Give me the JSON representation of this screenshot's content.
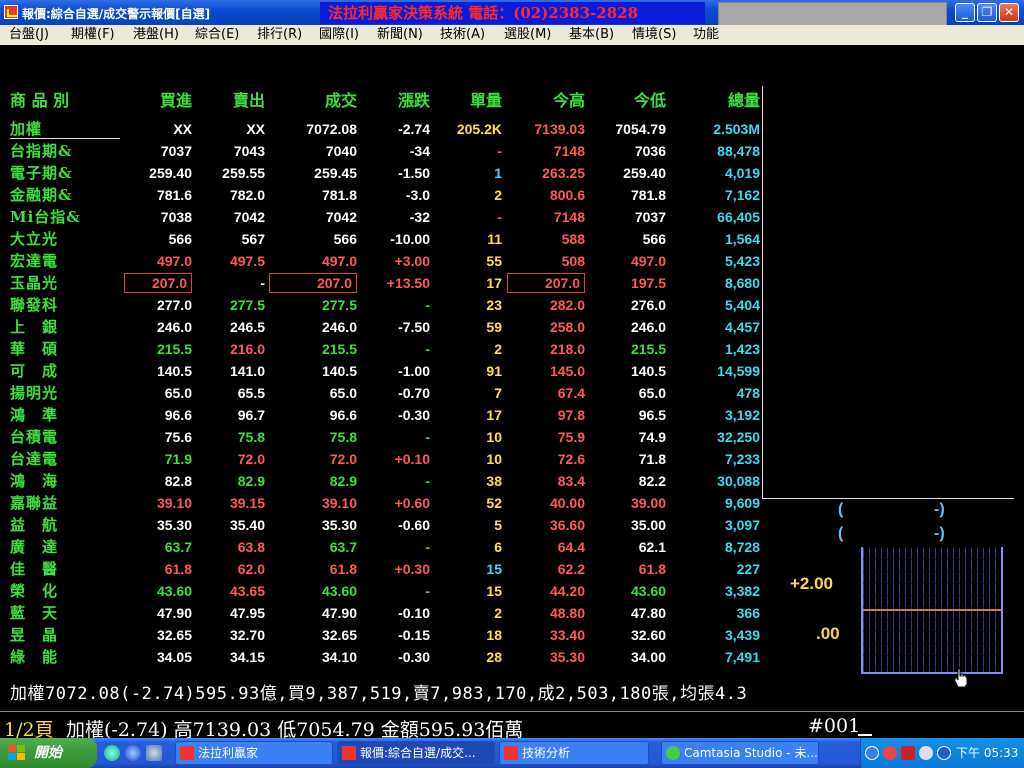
{
  "window": {
    "title": "報價:綜合自選/成交警示報價[自選]",
    "banner": "法拉利贏家決策系統 電話：(02)2383-2828",
    "btn_min": "_",
    "btn_max": "❐",
    "btn_close": "✕"
  },
  "menu": [
    {
      "label": "台盤(J)",
      "key": "台盤"
    },
    {
      "label": "期權(F)",
      "key": "期權"
    },
    {
      "label": "港盤(H)",
      "key": "港盤"
    },
    {
      "label": "綜合(E)",
      "key": "綜合"
    },
    {
      "label": "排行(R)",
      "key": "排行"
    },
    {
      "label": "國際(I)",
      "key": "國際"
    },
    {
      "label": "新聞(N)",
      "key": "新聞"
    },
    {
      "label": "技術(A)",
      "key": "技術"
    },
    {
      "label": "選股(M)",
      "key": "選股"
    },
    {
      "label": "基本(B)",
      "key": "基本"
    },
    {
      "label": "情境(S)",
      "key": "情境"
    },
    {
      "label": "功能",
      "key": "功能"
    }
  ],
  "table": {
    "headers": [
      "商 品 別",
      "買進",
      "賣出",
      "成交",
      "漲跌",
      "單量",
      "今高",
      "今低",
      "總量"
    ],
    "rows": [
      {
        "name": "加權",
        "name_color": "#3de03d",
        "c": [
          [
            "XX",
            "#ffffff"
          ],
          [
            "XX",
            "#ffffff"
          ],
          [
            "7072.08",
            "#ffffff"
          ],
          [
            "-2.74",
            "#ffffff"
          ],
          [
            "205.2K",
            "#ffe24a"
          ],
          [
            "7139.03",
            "#ff5a5a"
          ],
          [
            "7054.79",
            "#ffffff"
          ],
          [
            "2.503M",
            "#3cdcf0"
          ]
        ]
      },
      {
        "name": "台指期&",
        "name_color": "#3de03d",
        "c": [
          [
            "7037",
            "#ffffff"
          ],
          [
            "7043",
            "#ffffff"
          ],
          [
            "7040",
            "#ffffff"
          ],
          [
            "-34",
            "#ffffff"
          ],
          [
            "-",
            "#ff5a5a"
          ],
          [
            "7148",
            "#ff5a5a"
          ],
          [
            "7036",
            "#ffffff"
          ],
          [
            "88,478",
            "#3cdcf0"
          ]
        ]
      },
      {
        "name": "電子期&",
        "name_color": "#3de03d",
        "c": [
          [
            "259.40",
            "#ffffff"
          ],
          [
            "259.55",
            "#ffffff"
          ],
          [
            "259.45",
            "#ffffff"
          ],
          [
            "-1.50",
            "#ffffff"
          ],
          [
            "1",
            "#3cdcf0"
          ],
          [
            "263.25",
            "#ff5a5a"
          ],
          [
            "259.40",
            "#ffffff"
          ],
          [
            "4,019",
            "#3cdcf0"
          ]
        ]
      },
      {
        "name": "金融期&",
        "name_color": "#3de03d",
        "c": [
          [
            "781.6",
            "#ffffff"
          ],
          [
            "782.0",
            "#ffffff"
          ],
          [
            "781.8",
            "#ffffff"
          ],
          [
            "-3.0",
            "#ffffff"
          ],
          [
            "2",
            "#ffe24a"
          ],
          [
            "800.6",
            "#ff5a5a"
          ],
          [
            "781.8",
            "#ffffff"
          ],
          [
            "7,162",
            "#3cdcf0"
          ]
        ]
      },
      {
        "name": "Mi台指&",
        "name_color": "#3de03d",
        "c": [
          [
            "7038",
            "#ffffff"
          ],
          [
            "7042",
            "#ffffff"
          ],
          [
            "7042",
            "#ffffff"
          ],
          [
            "-32",
            "#ffffff"
          ],
          [
            "-",
            "#ff5a5a"
          ],
          [
            "7148",
            "#ff5a5a"
          ],
          [
            "7037",
            "#ffffff"
          ],
          [
            "66,405",
            "#3cdcf0"
          ]
        ]
      },
      {
        "name": "大立光",
        "name_color": "#3de03d",
        "c": [
          [
            "566",
            "#ffffff"
          ],
          [
            "567",
            "#ffffff"
          ],
          [
            "566",
            "#ffffff"
          ],
          [
            "-10.00",
            "#ffffff"
          ],
          [
            "11",
            "#ffe24a"
          ],
          [
            "588",
            "#ff5a5a"
          ],
          [
            "566",
            "#ffffff"
          ],
          [
            "1,564",
            "#3cdcf0"
          ]
        ]
      },
      {
        "name": "宏達電",
        "name_color": "#3de03d",
        "c": [
          [
            "497.0",
            "#ff5a5a"
          ],
          [
            "497.5",
            "#ff5a5a"
          ],
          [
            "497.0",
            "#ff5a5a"
          ],
          [
            "+3.00",
            "#ff5a5a"
          ],
          [
            "55",
            "#ffe24a"
          ],
          [
            "508",
            "#ff5a5a"
          ],
          [
            "497.0",
            "#ff5a5a"
          ],
          [
            "5,423",
            "#3cdcf0"
          ]
        ]
      },
      {
        "name": "玉晶光",
        "name_color": "#3de03d",
        "c": [
          [
            "207.0",
            "#ff5a5a"
          ],
          [
            "-",
            "#ffffff"
          ],
          [
            "207.0",
            "#ff5a5a"
          ],
          [
            "+13.50",
            "#ff5a5a"
          ],
          [
            "17",
            "#ffe24a"
          ],
          [
            "207.0",
            "#ff5a5a"
          ],
          [
            "197.5",
            "#ff5a5a"
          ],
          [
            "8,680",
            "#3cdcf0"
          ]
        ],
        "boxed": [
          0,
          2,
          5
        ]
      },
      {
        "name": "聯發科",
        "name_color": "#3de03d",
        "c": [
          [
            "277.0",
            "#ffffff"
          ],
          [
            "277.5",
            "#3de03d"
          ],
          [
            "277.5",
            "#3de03d"
          ],
          [
            "-",
            "#3de03d"
          ],
          [
            "23",
            "#ffe24a"
          ],
          [
            "282.0",
            "#ff5a5a"
          ],
          [
            "276.0",
            "#ffffff"
          ],
          [
            "5,404",
            "#3cdcf0"
          ]
        ]
      },
      {
        "name": "上　銀",
        "name_color": "#3de03d",
        "c": [
          [
            "246.0",
            "#ffffff"
          ],
          [
            "246.5",
            "#ffffff"
          ],
          [
            "246.0",
            "#ffffff"
          ],
          [
            "-7.50",
            "#ffffff"
          ],
          [
            "59",
            "#ffe24a"
          ],
          [
            "258.0",
            "#ff5a5a"
          ],
          [
            "246.0",
            "#ffffff"
          ],
          [
            "4,457",
            "#3cdcf0"
          ]
        ]
      },
      {
        "name": "華　碩",
        "name_color": "#3de03d",
        "c": [
          [
            "215.5",
            "#3de03d"
          ],
          [
            "216.0",
            "#ff5a5a"
          ],
          [
            "215.5",
            "#3de03d"
          ],
          [
            "-",
            "#3de03d"
          ],
          [
            "2",
            "#ffe24a"
          ],
          [
            "218.0",
            "#ff5a5a"
          ],
          [
            "215.5",
            "#3de03d"
          ],
          [
            "1,423",
            "#3cdcf0"
          ]
        ]
      },
      {
        "name": "可　成",
        "name_color": "#3de03d",
        "c": [
          [
            "140.5",
            "#ffffff"
          ],
          [
            "141.0",
            "#ffffff"
          ],
          [
            "140.5",
            "#ffffff"
          ],
          [
            "-1.00",
            "#ffffff"
          ],
          [
            "91",
            "#ffe24a"
          ],
          [
            "145.0",
            "#ff5a5a"
          ],
          [
            "140.5",
            "#ffffff"
          ],
          [
            "14,599",
            "#3cdcf0"
          ]
        ]
      },
      {
        "name": "揚明光",
        "name_color": "#3de03d",
        "c": [
          [
            "65.0",
            "#ffffff"
          ],
          [
            "65.5",
            "#ffffff"
          ],
          [
            "65.0",
            "#ffffff"
          ],
          [
            "-0.70",
            "#ffffff"
          ],
          [
            "7",
            "#ffe24a"
          ],
          [
            "67.4",
            "#ff5a5a"
          ],
          [
            "65.0",
            "#ffffff"
          ],
          [
            "478",
            "#3cdcf0"
          ]
        ]
      },
      {
        "name": "鴻　準",
        "name_color": "#3de03d",
        "c": [
          [
            "96.6",
            "#ffffff"
          ],
          [
            "96.7",
            "#ffffff"
          ],
          [
            "96.6",
            "#ffffff"
          ],
          [
            "-0.30",
            "#ffffff"
          ],
          [
            "17",
            "#ffe24a"
          ],
          [
            "97.8",
            "#ff5a5a"
          ],
          [
            "96.5",
            "#ffffff"
          ],
          [
            "3,192",
            "#3cdcf0"
          ]
        ]
      },
      {
        "name": "台積電",
        "name_color": "#3de03d",
        "c": [
          [
            "75.6",
            "#ffffff"
          ],
          [
            "75.8",
            "#3de03d"
          ],
          [
            "75.8",
            "#3de03d"
          ],
          [
            "-",
            "#3de03d"
          ],
          [
            "10",
            "#ffe24a"
          ],
          [
            "75.9",
            "#ff5a5a"
          ],
          [
            "74.9",
            "#ffffff"
          ],
          [
            "32,250",
            "#3cdcf0"
          ]
        ]
      },
      {
        "name": "台達電",
        "name_color": "#3de03d",
        "c": [
          [
            "71.9",
            "#3de03d"
          ],
          [
            "72.0",
            "#ff5a5a"
          ],
          [
            "72.0",
            "#ff5a5a"
          ],
          [
            "+0.10",
            "#ff5a5a"
          ],
          [
            "10",
            "#ffe24a"
          ],
          [
            "72.6",
            "#ff5a5a"
          ],
          [
            "71.8",
            "#ffffff"
          ],
          [
            "7,233",
            "#3cdcf0"
          ]
        ]
      },
      {
        "name": "鴻　海",
        "name_color": "#3de03d",
        "c": [
          [
            "82.8",
            "#ffffff"
          ],
          [
            "82.9",
            "#3de03d"
          ],
          [
            "82.9",
            "#3de03d"
          ],
          [
            "-",
            "#3de03d"
          ],
          [
            "38",
            "#ffe24a"
          ],
          [
            "83.4",
            "#ff5a5a"
          ],
          [
            "82.2",
            "#ffffff"
          ],
          [
            "30,088",
            "#3cdcf0"
          ]
        ]
      },
      {
        "name": "嘉聯益",
        "name_color": "#3de03d",
        "c": [
          [
            "39.10",
            "#ff5a5a"
          ],
          [
            "39.15",
            "#ff5a5a"
          ],
          [
            "39.10",
            "#ff5a5a"
          ],
          [
            "+0.60",
            "#ff5a5a"
          ],
          [
            "52",
            "#ffe24a"
          ],
          [
            "40.00",
            "#ff5a5a"
          ],
          [
            "39.00",
            "#ff5a5a"
          ],
          [
            "9,609",
            "#3cdcf0"
          ]
        ]
      },
      {
        "name": "益　航",
        "name_color": "#3de03d",
        "c": [
          [
            "35.30",
            "#ffffff"
          ],
          [
            "35.40",
            "#ffffff"
          ],
          [
            "35.30",
            "#ffffff"
          ],
          [
            "-0.60",
            "#ffffff"
          ],
          [
            "5",
            "#ffe24a"
          ],
          [
            "36.60",
            "#ff5a5a"
          ],
          [
            "35.00",
            "#ffffff"
          ],
          [
            "3,097",
            "#3cdcf0"
          ]
        ]
      },
      {
        "name": "廣　達",
        "name_color": "#3de03d",
        "c": [
          [
            "63.7",
            "#3de03d"
          ],
          [
            "63.8",
            "#ff5a5a"
          ],
          [
            "63.7",
            "#3de03d"
          ],
          [
            "-",
            "#3de03d"
          ],
          [
            "6",
            "#ffe24a"
          ],
          [
            "64.4",
            "#ff5a5a"
          ],
          [
            "62.1",
            "#ffffff"
          ],
          [
            "8,728",
            "#3cdcf0"
          ]
        ]
      },
      {
        "name": "佳　醫",
        "name_color": "#3de03d",
        "c": [
          [
            "61.8",
            "#ff5a5a"
          ],
          [
            "62.0",
            "#ff5a5a"
          ],
          [
            "61.8",
            "#ff5a5a"
          ],
          [
            "+0.30",
            "#ff5a5a"
          ],
          [
            "15",
            "#3cdcf0"
          ],
          [
            "62.2",
            "#ff5a5a"
          ],
          [
            "61.8",
            "#ff5a5a"
          ],
          [
            "227",
            "#3cdcf0"
          ]
        ]
      },
      {
        "name": "榮　化",
        "name_color": "#3de03d",
        "c": [
          [
            "43.60",
            "#3de03d"
          ],
          [
            "43.65",
            "#ff5a5a"
          ],
          [
            "43.60",
            "#3de03d"
          ],
          [
            "-",
            "#3de03d"
          ],
          [
            "15",
            "#ffe24a"
          ],
          [
            "44.20",
            "#ff5a5a"
          ],
          [
            "43.60",
            "#3de03d"
          ],
          [
            "3,382",
            "#3cdcf0"
          ]
        ]
      },
      {
        "name": "藍　天",
        "name_color": "#3de03d",
        "c": [
          [
            "47.90",
            "#ffffff"
          ],
          [
            "47.95",
            "#ffffff"
          ],
          [
            "47.90",
            "#ffffff"
          ],
          [
            "-0.10",
            "#ffffff"
          ],
          [
            "2",
            "#ffe24a"
          ],
          [
            "48.80",
            "#ff5a5a"
          ],
          [
            "47.80",
            "#ffffff"
          ],
          [
            "366",
            "#3cdcf0"
          ]
        ]
      },
      {
        "name": "昱　晶",
        "name_color": "#3de03d",
        "c": [
          [
            "32.65",
            "#ffffff"
          ],
          [
            "32.70",
            "#ffffff"
          ],
          [
            "32.65",
            "#ffffff"
          ],
          [
            "-0.15",
            "#ffffff"
          ],
          [
            "18",
            "#ffe24a"
          ],
          [
            "33.40",
            "#ff5a5a"
          ],
          [
            "32.60",
            "#ffffff"
          ],
          [
            "3,439",
            "#3cdcf0"
          ]
        ]
      },
      {
        "name": "綠　能",
        "name_color": "#3de03d",
        "c": [
          [
            "34.05",
            "#ffffff"
          ],
          [
            "34.15",
            "#ffffff"
          ],
          [
            "34.10",
            "#ffffff"
          ],
          [
            "-0.30",
            "#ffffff"
          ],
          [
            "28",
            "#ffe24a"
          ],
          [
            "35.30",
            "#ff5a5a"
          ],
          [
            "34.00",
            "#ffffff"
          ],
          [
            "7,491",
            "#3cdcf0"
          ]
        ]
      }
    ]
  },
  "right_panel": {
    "paren1_open": "(",
    "paren1_close": "-)",
    "paren2_open": "(",
    "paren2_close": "-)",
    "upper_value": "+2.00",
    "lower_value": ".00"
  },
  "summary": "加權7072.08(-2.74)595.93億,買9,387,519,賣7,983,170,成2,503,180張,均張4.3",
  "bottom": {
    "page": "1/2頁",
    "text": "加權(-2.74) 高7139.03 低7054.79 金額595.93佰萬",
    "code": "#001"
  },
  "taskbar": {
    "start": "開始",
    "tasks": [
      {
        "label": "法拉利贏家",
        "active": false
      },
      {
        "label": "報價:綜合自選/成交...",
        "active": true
      },
      {
        "label": "技術分析",
        "active": false
      },
      {
        "label": "Camtasia Studio - 未...",
        "active": false
      }
    ],
    "clock": "下午 05:33"
  }
}
